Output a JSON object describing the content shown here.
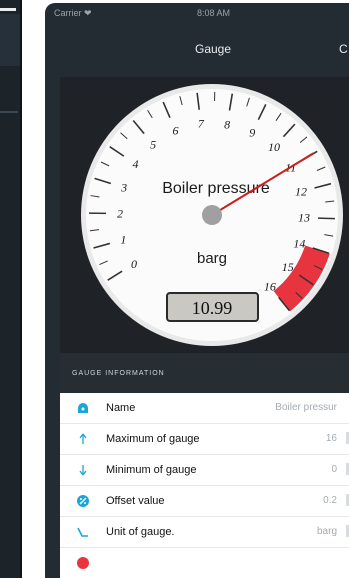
{
  "status_bar": {
    "carrier": "Carrier ❤",
    "time": "8:08 AM"
  },
  "nav": {
    "title": "Gauge",
    "right_button": "C"
  },
  "gauge": {
    "title": "Boiler pressure",
    "unit": "barg",
    "value_display": "10.99",
    "min": 0,
    "max": 16,
    "value": 10.99,
    "red_zone_start": 14,
    "red_zone_end": 16,
    "scale_labels": [
      "0",
      "1",
      "2",
      "3",
      "4",
      "5",
      "6",
      "7",
      "8",
      "9",
      "10",
      "11",
      "12",
      "13",
      "14",
      "15",
      "16"
    ],
    "colors": {
      "dial_background": "#fbfbfb",
      "needle": "#c8201a",
      "red_zone": "#e8343f",
      "value_box": "#c9c8c3",
      "pivot": "#a0a0a0"
    }
  },
  "section": {
    "title": "GAUGE INFORMATION"
  },
  "rows": [
    {
      "icon": "gauge-icon",
      "label": "Name",
      "value": "Boiler pressur"
    },
    {
      "icon": "arrow-up-icon",
      "label": "Maximum of gauge",
      "value": "16"
    },
    {
      "icon": "arrow-down-icon",
      "label": "Minimum of gauge",
      "value": "0"
    },
    {
      "icon": "offset-icon",
      "label": "Offset value",
      "value": "0.2"
    },
    {
      "icon": "unit-icon",
      "label": "Unit of gauge.",
      "value": "barg"
    }
  ],
  "theme": {
    "accent": "#1aa7d6",
    "alert": "#e8343f"
  }
}
